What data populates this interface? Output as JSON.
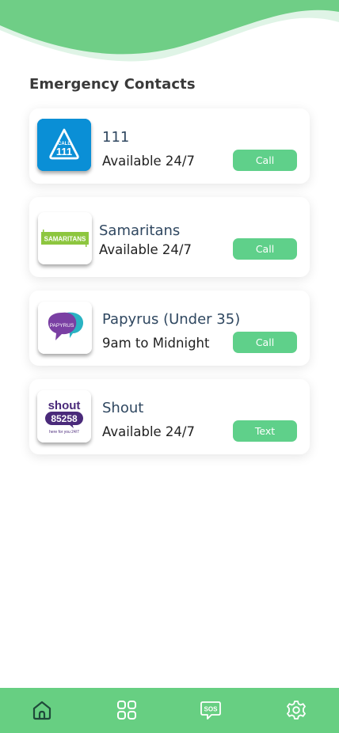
{
  "page": {
    "title": "Emergency Contacts"
  },
  "contacts": [
    {
      "logo": "call-111-logo",
      "logo_text": "CALL 111",
      "name": "111",
      "availability": "Available 24/7",
      "action_label": "Call"
    },
    {
      "logo": "samaritans-logo",
      "logo_text": "SAMARITANS",
      "name": "Samaritans",
      "availability": "Available 24/7",
      "action_label": "Call"
    },
    {
      "logo": "papyrus-logo",
      "logo_text": "PAPYRUS",
      "name": "Papyrus (Under 35)",
      "availability": "9am to Midnight",
      "action_label": "Call"
    },
    {
      "logo": "shout-logo",
      "logo_text": "shout 85258 here for you 24/7",
      "name": "Shout",
      "availability": "Available 24/7",
      "action_label": "Text"
    }
  ],
  "nav": {
    "items": [
      {
        "icon": "home-icon",
        "active": true
      },
      {
        "icon": "grid-icon",
        "active": false
      },
      {
        "icon": "sos-chat-icon",
        "active": false
      },
      {
        "icon": "gear-icon",
        "active": false
      }
    ]
  },
  "colors": {
    "accent_green": "#5fd08a",
    "nav_green": "#67cf82",
    "header_wave": "#6fce86",
    "header_wave_light": "#dff4e6",
    "title_text": "#3a3a3a",
    "name_text": "#2f4760"
  }
}
